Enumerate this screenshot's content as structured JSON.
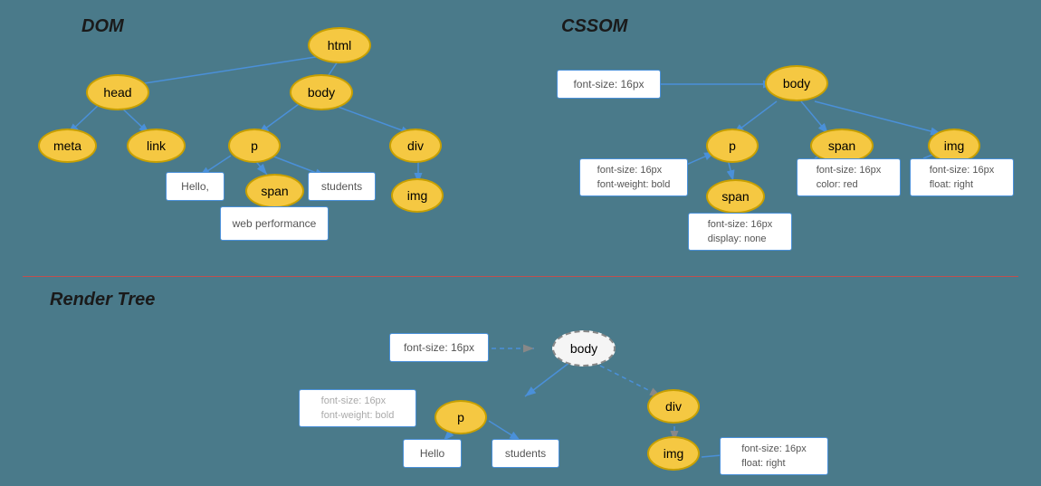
{
  "dom": {
    "title": "DOM",
    "nodes": {
      "html": "html",
      "head": "head",
      "body": "body",
      "meta": "meta",
      "link": "link",
      "p": "p",
      "span_dom": "span",
      "div_dom": "div",
      "img_dom": "img"
    },
    "rects": {
      "hello": "Hello,",
      "students": "students",
      "web_performance": "web performance"
    }
  },
  "cssom": {
    "title": "CSSOM",
    "nodes": {
      "body": "body",
      "p": "p",
      "span_cssom": "span",
      "img_cssom": "img",
      "span_inner": "span"
    },
    "rects": {
      "body_style": "font-size: 16px",
      "p_style": "font-size: 16px\nfont-weight: bold",
      "span_style": "font-size: 16px\ncolor: red",
      "img_style": "font-size: 16px\nfloat: right",
      "span_inner_style": "font-size: 16px\ndisplay: none"
    }
  },
  "render_tree": {
    "title": "Render Tree",
    "nodes": {
      "body": "body",
      "p": "p",
      "div": "div",
      "img": "img"
    },
    "rects": {
      "body_style": "font-size: 16px",
      "p_style": "font-size: 16px\nfont-weight: bold",
      "img_style": "font-size: 16px\nfloat: right",
      "hello": "Hello",
      "students": "students"
    }
  }
}
